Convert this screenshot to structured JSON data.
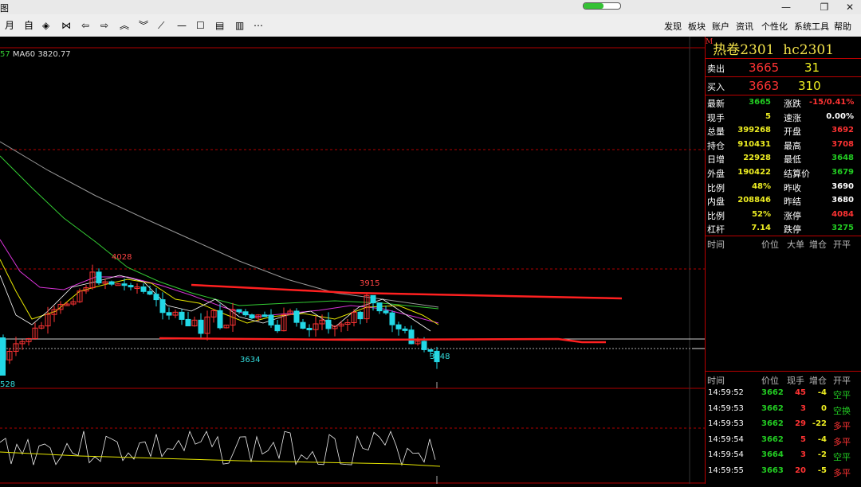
{
  "window": {
    "title_fragment": "图"
  },
  "toolbar": {
    "period": "月",
    "auto": "自",
    "menus": [
      "发现",
      "板块",
      "账户",
      "资讯",
      "个性化",
      "系统工具",
      "帮助"
    ],
    "progress": 0.55
  },
  "indicator": {
    "prefix": "57",
    "ma60_label": "MA60",
    "ma60_value": "3820.77"
  },
  "chart_labels": {
    "high1": "4028",
    "high2": "3915",
    "low1": "3634",
    "low2": "3648",
    "bottom_left": "528"
  },
  "quote": {
    "marker": "M",
    "name": "热卷2301",
    "code": "hc2301",
    "sell": {
      "label": "卖出",
      "price": "3665",
      "vol": "31"
    },
    "buy": {
      "label": "买入",
      "price": "3663",
      "vol": "310"
    },
    "left": [
      {
        "label": "最新",
        "value": "3665"
      },
      {
        "label": "现手",
        "value": "5"
      },
      {
        "label": "总量",
        "value": "399268"
      },
      {
        "label": "持仓",
        "value": "910431"
      },
      {
        "label": "日增",
        "value": "22928"
      },
      {
        "label": "外盘",
        "value": "190422"
      },
      {
        "label": "比例",
        "value": "48%"
      },
      {
        "label": "内盘",
        "value": "208846"
      },
      {
        "label": "比例",
        "value": "52%"
      },
      {
        "label": "杠杆",
        "value": "7.14"
      }
    ],
    "right": [
      {
        "label": "涨跌",
        "value": "-15/0.41%"
      },
      {
        "label": "速涨",
        "value": "0.00%"
      },
      {
        "label": "开盘",
        "value": "3692"
      },
      {
        "label": "最高",
        "value": "3708"
      },
      {
        "label": "最低",
        "value": "3648"
      },
      {
        "label": "结算价",
        "value": "3679"
      },
      {
        "label": "昨收",
        "value": "3690"
      },
      {
        "label": "昨结",
        "value": "3680"
      },
      {
        "label": "涨停",
        "value": "4084"
      },
      {
        "label": "跌停",
        "value": "3275"
      }
    ]
  },
  "orderbook_header": [
    "时间",
    "价位",
    "大单",
    "增仓",
    "开平"
  ],
  "ticks_header": [
    "时间",
    "价位",
    "现手",
    "增仓",
    "开平"
  ],
  "ticks": [
    {
      "time": "14:59:52",
      "price": "3662",
      "vol": "45",
      "chg": "-4",
      "type": "空平"
    },
    {
      "time": "14:59:53",
      "price": "3662",
      "vol": "3",
      "chg": "0",
      "type": "空换"
    },
    {
      "time": "14:59:53",
      "price": "3662",
      "vol": "29",
      "chg": "-22",
      "type": "多平"
    },
    {
      "time": "14:59:54",
      "price": "3662",
      "vol": "5",
      "chg": "-4",
      "type": "多平"
    },
    {
      "time": "14:59:54",
      "price": "3664",
      "vol": "3",
      "chg": "-2",
      "type": "空平"
    },
    {
      "time": "14:59:55",
      "price": "3663",
      "vol": "20",
      "chg": "-5",
      "type": "多平"
    }
  ],
  "colors": {
    "up": "#ff3333",
    "down": "#22d8e6",
    "grid": "#b00000",
    "ma5": "#ffffff",
    "ma10": "#e6e600",
    "ma20": "#d633d6",
    "ma40": "#33cc33",
    "ma60": "#999999"
  }
}
